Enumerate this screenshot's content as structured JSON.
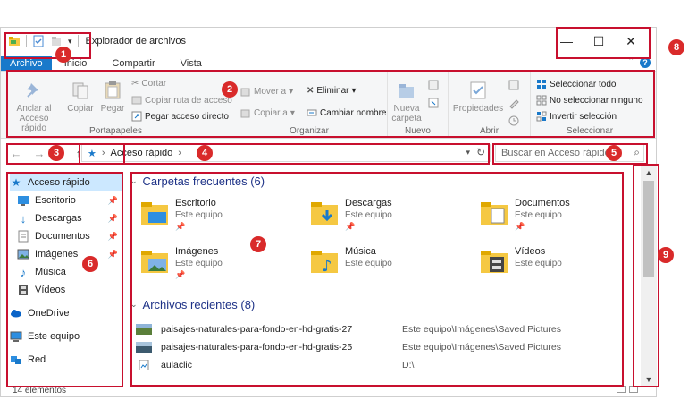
{
  "window": {
    "title": "Explorador de archivos",
    "controls": {
      "minimize": "—",
      "maximize": "☐",
      "close": "✕"
    }
  },
  "tabs": [
    "Archivo",
    "Inicio",
    "Compartir",
    "Vista"
  ],
  "ribbon": {
    "portapapeles": {
      "label": "Portapapeles",
      "anclar": "Anclar al Acceso rápido",
      "copiar": "Copiar",
      "pegar": "Pegar",
      "cortar": "Cortar",
      "copiar_ruta": "Copiar ruta de acceso",
      "pegar_acceso": "Pegar acceso directo"
    },
    "organizar": {
      "label": "Organizar",
      "mover": "Mover a",
      "copiar_a": "Copiar a",
      "eliminar": "Eliminar",
      "cambiar_nombre": "Cambiar nombre"
    },
    "nuevo": {
      "label": "Nuevo",
      "nueva_carpeta": "Nueva carpeta"
    },
    "abrir": {
      "label": "Abrir",
      "propiedades": "Propiedades"
    },
    "seleccionar": {
      "label": "Seleccionar",
      "todo": "Seleccionar todo",
      "ninguno": "No seleccionar ninguno",
      "invertir": "Invertir selección"
    }
  },
  "address": {
    "path": "Acceso rápido",
    "separator": "›",
    "search_placeholder": "Buscar en Acceso rápido"
  },
  "nav": {
    "items": [
      {
        "label": "Acceso rápido"
      },
      {
        "label": "Escritorio"
      },
      {
        "label": "Descargas"
      },
      {
        "label": "Documentos"
      },
      {
        "label": "Imágenes"
      },
      {
        "label": "Música"
      },
      {
        "label": "Vídeos"
      },
      {
        "label": "OneDrive"
      },
      {
        "label": "Este equipo"
      },
      {
        "label": "Red"
      }
    ]
  },
  "content": {
    "frequent_title": "Carpetas frecuentes (6)",
    "folders": [
      {
        "name": "Escritorio",
        "loc": "Este equipo"
      },
      {
        "name": "Descargas",
        "loc": "Este equipo"
      },
      {
        "name": "Documentos",
        "loc": "Este equipo"
      },
      {
        "name": "Imágenes",
        "loc": "Este equipo"
      },
      {
        "name": "Música",
        "loc": "Este equipo"
      },
      {
        "name": "Vídeos",
        "loc": "Este equipo"
      }
    ],
    "recent_title": "Archivos recientes (8)",
    "recent": [
      {
        "name": "paisajes-naturales-para-fondo-en-hd-gratis-27",
        "path": "Este equipo\\Imágenes\\Saved Pictures"
      },
      {
        "name": "paisajes-naturales-para-fondo-en-hd-gratis-25",
        "path": "Este equipo\\Imágenes\\Saved Pictures"
      },
      {
        "name": "aulaclic",
        "path": "D:\\"
      }
    ]
  },
  "status": {
    "count": "14 elementos"
  },
  "annotations": [
    "1",
    "2",
    "3",
    "4",
    "5",
    "6",
    "7",
    "8",
    "9"
  ],
  "colors": {
    "accent": "#1979ca",
    "annotation": "#c8102e",
    "link_title": "#1e3287",
    "folder": "#f5c842"
  }
}
